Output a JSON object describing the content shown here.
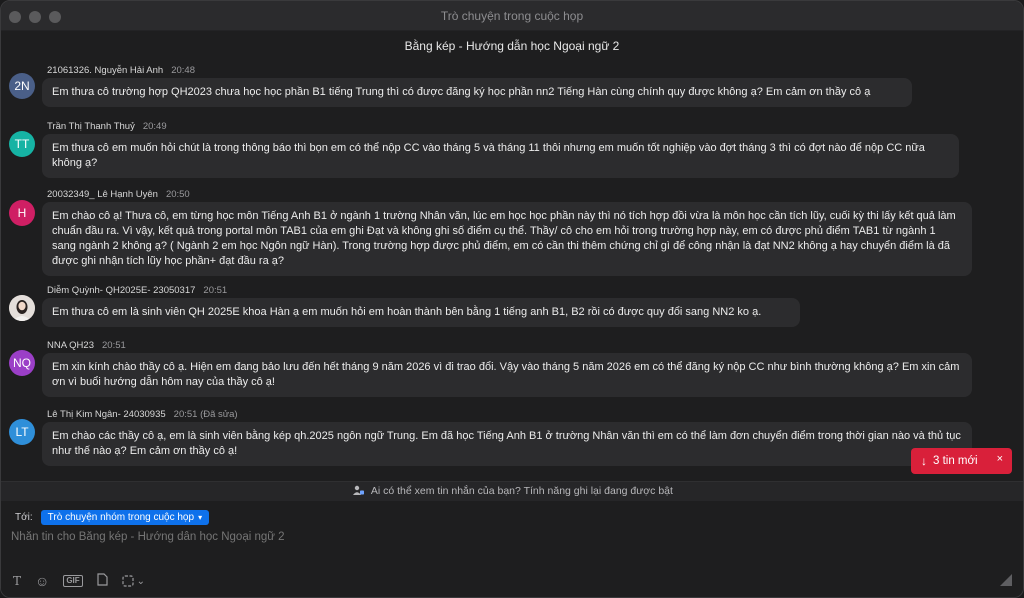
{
  "window": {
    "title": "Trò chuyện trong cuộc họp"
  },
  "chat": {
    "header": "Bằng kép - Hướng dẫn học Ngoại ngữ 2"
  },
  "messages": [
    {
      "initials": "2N",
      "color": "#4a5f88",
      "sender": "21061326. Nguyễn Hải Anh",
      "time": "20:48",
      "text": "Em thưa cô trường hợp QH2023 chưa học học phần B1 tiếng Trung thì có được đăng ký học phần nn2 Tiếng Hàn cùng chính quy được không ạ? Em cảm ơn thầy cô ạ"
    },
    {
      "initials": "TT",
      "color": "#16b3a4",
      "sender": "Trần Thị Thanh Thuỷ",
      "time": "20:49",
      "text": "Em thưa cô em muốn hỏi chút là trong thông báo thì bọn em có thể nộp CC vào tháng 5 và tháng 11 thôi nhưng em muốn tốt nghiệp vào đợt tháng 3 thì có đợt nào để nộp CC nữa không ạ?"
    },
    {
      "initials": "H",
      "color": "#cf1f64",
      "sender": "20032349_ Lê Hạnh Uyên",
      "time": "20:50",
      "text": "Em chào cô ạ! Thưa cô, em từng học môn Tiếng Anh B1 ở ngành 1 trường Nhân văn, lúc em học học phần này thì nó tích hợp đồi vừa là môn học cần tích lũy, cuối kỳ thi lấy kết quả làm chuẩn đầu ra. Vì vậy, kết quả trong portal môn TAB1 của em ghi Đạt và không ghi số điểm cụ thể. Thầy/ cô cho em hỏi trong trường hợp này, em có được phủ điểm TAB1 từ ngành 1 sang ngành 2 không ạ? ( Ngành 2 em học Ngôn ngữ Hàn). Trong trường hợp được phủ điểm, em có cần thi thêm chứng chỉ gì để công nhận là đạt NN2 không ạ hay chuyển điểm là đã được ghi nhận tích lũy học phần+ đạt đầu ra ạ?"
    },
    {
      "initials": "",
      "color": "#d9d3cf",
      "sender": "Diễm Quỳnh- QH2025E- 23050317",
      "time": "20:51",
      "text": "Em thưa cô em là sinh viên QH 2025E khoa Hàn ạ em muốn hỏi em hoàn thành bên bằng 1 tiếng anh B1, B2 rồi  có được quy đổi sang NN2 ko ạ."
    },
    {
      "initials": "NQ",
      "color": "#9b3fc7",
      "sender": "NNA QH23",
      "time": "20:51",
      "text": "Em xin kính chào thầy cô ạ. Hiện em đang bảo lưu đến hết tháng 9 năm 2026 vì đi trao đổi. Vậy vào tháng 5 năm 2026 em có thể đăng ký nộp CC như bình thường không ạ? Em xin cảm ơn vì buổi hướng dẫn hôm nay của thầy cô ạ!"
    },
    {
      "initials": "LT",
      "color": "#2f8fd9",
      "sender": "Lê Thị Kim Ngân- 24030935",
      "time": "20:51 (Đã sửa)",
      "text": "Em chào các thầy cô ạ, em là sinh viên bằng kép qh.2025 ngôn ngữ Trung. Em đã học Tiếng Anh B1 ở trường Nhân văn thì em có thể làm đơn chuyển điểm trong thời gian nào và thủ tục như thế nào ạ? Em cảm ơn thầy cô ạ!"
    }
  ],
  "new_messages": {
    "label": "3 tin mới",
    "close": "×",
    "arrow": "↓"
  },
  "notice": {
    "text": "Ai có thể xem tin nhắn của bạn? Tính năng ghi lại đang được bật"
  },
  "composer": {
    "to_label": "Tới:",
    "recipient": "Trò chuyện nhóm trong cuộc họp",
    "placeholder": "Nhắn tin cho Bằng kép - Hướng dẫn học Ngoại ngữ 2",
    "tools": {
      "text": "T",
      "emoji": "☺",
      "gif": "GIF",
      "file": "▢",
      "screenshot": "⬚",
      "more": "⌄",
      "send": "➤"
    }
  }
}
